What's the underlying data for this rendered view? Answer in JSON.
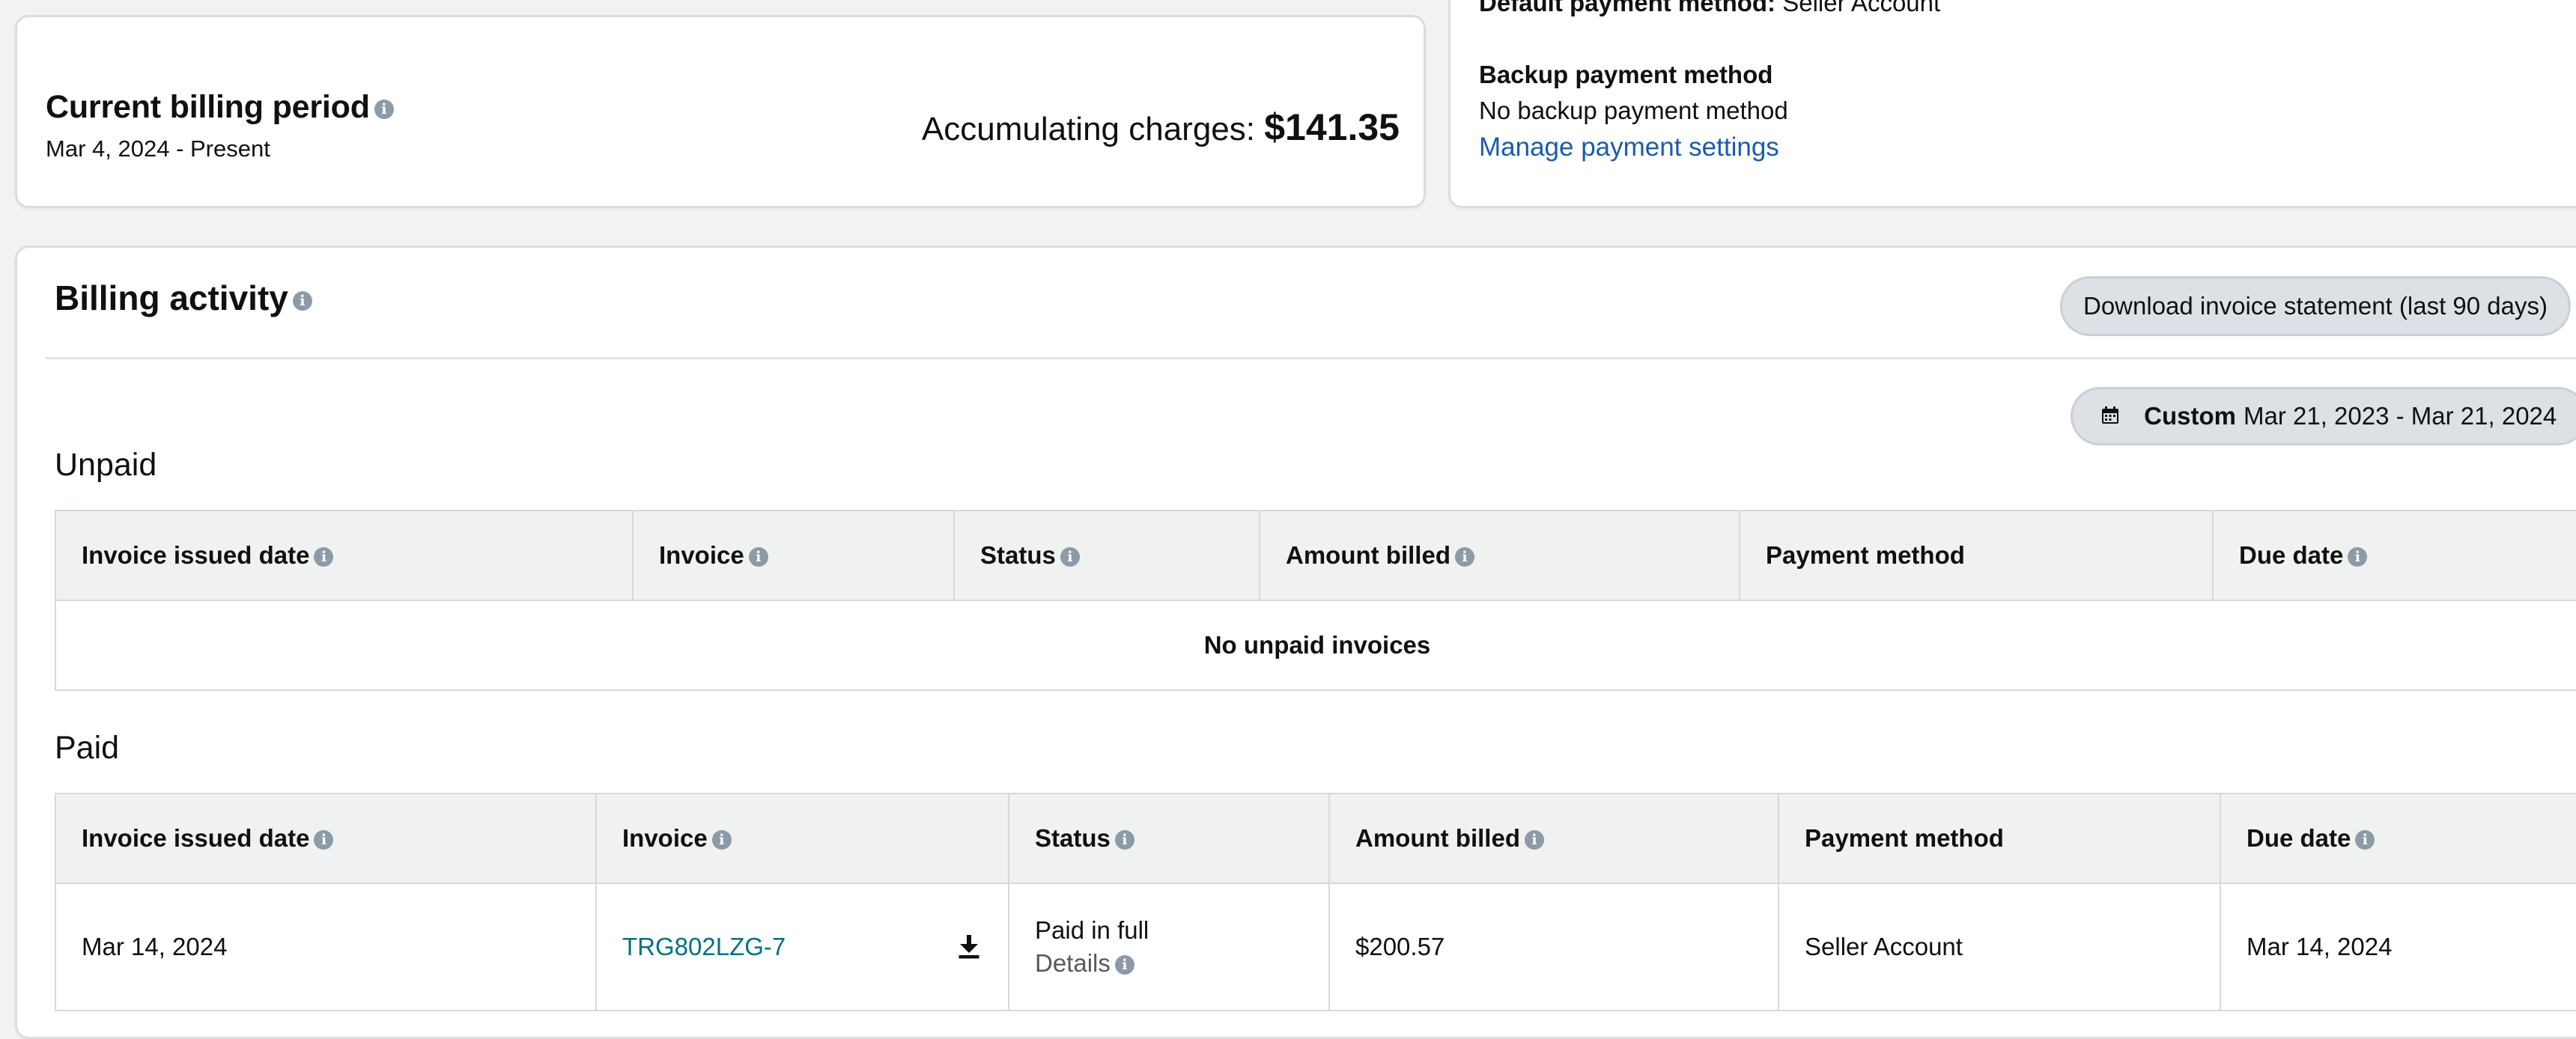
{
  "billing_period": {
    "title": "Current billing period",
    "range": "Mar 4, 2024 - Present",
    "accum_label": "Accumulating charges:",
    "accum_amount": "$141.35"
  },
  "payment": {
    "default_label": "Default payment method:",
    "default_value": "Seller Account",
    "backup_label": "Backup payment method",
    "backup_value": "No backup payment method",
    "manage_link": "Manage payment settings"
  },
  "activity": {
    "title": "Billing activity",
    "download_button": "Download invoice statement (last 90 days)",
    "date_filter": {
      "mode": "Custom",
      "range": "Mar 21, 2023 - Mar 21, 2024"
    },
    "columns": [
      "Invoice issued date",
      "Invoice",
      "Status",
      "Amount billed",
      "Payment method",
      "Due date"
    ],
    "unpaid": {
      "title": "Unpaid",
      "empty_message": "No unpaid invoices"
    },
    "paid": {
      "title": "Paid",
      "rows": [
        {
          "issued_date": "Mar 14, 2024",
          "invoice": "TRG802LZG-7",
          "status": "Paid in full",
          "status_details": "Details",
          "amount": "$200.57",
          "payment_method": "Seller Account",
          "due_date": "Mar 14, 2024"
        }
      ]
    }
  },
  "colors": {
    "link": "#1a5cad",
    "invoice_link": "#007185",
    "header_bg": "#f0f2f2",
    "button_bg": "#dde1e6"
  }
}
